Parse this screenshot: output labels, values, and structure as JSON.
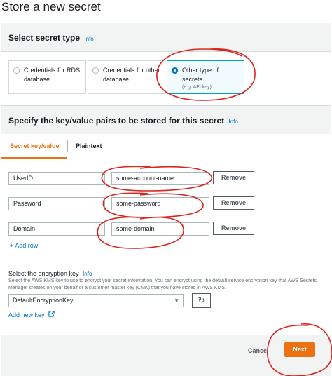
{
  "page": {
    "title": "Store a new secret"
  },
  "secret_type": {
    "heading": "Select secret type",
    "info": "Info",
    "options": [
      {
        "label": "Credentials for RDS database",
        "sublabel": "",
        "selected": false
      },
      {
        "label": "Credentials for other database",
        "sublabel": "",
        "selected": false
      },
      {
        "label": "Other type of secrets",
        "sublabel": "(e.g. API key)",
        "selected": true
      }
    ]
  },
  "kv": {
    "heading": "Specify the key/value pairs to be stored for this secret",
    "info": "Info",
    "tabs": [
      {
        "label": "Secret key/value",
        "active": true
      },
      {
        "label": "Plaintext",
        "active": false
      }
    ],
    "rows": [
      {
        "key": "UserID",
        "value": "some-account-name",
        "remove": "Remove"
      },
      {
        "key": "Password",
        "value": "some-password",
        "remove": "Remove"
      },
      {
        "key": "Domain",
        "value": "some-domain",
        "remove": "Remove"
      }
    ],
    "add_row": "+ Add row"
  },
  "encryption": {
    "label": "Select the encryption key",
    "info": "Info",
    "description": "Select the AWS KMS key to use to encrypt your secret information. You can encrypt using the default service encryption key that AWS Secrets Manager creates on your behalf or a customer master key (CMK) that you have stored in AWS KMS.",
    "selected_key": "DefaultEncryptionKey",
    "add_key": "Add new key"
  },
  "footer": {
    "cancel": "Cancel",
    "next": "Next"
  },
  "colors": {
    "accent": "#ec7211",
    "link": "#0073bb",
    "annotation": "#d9261c"
  }
}
